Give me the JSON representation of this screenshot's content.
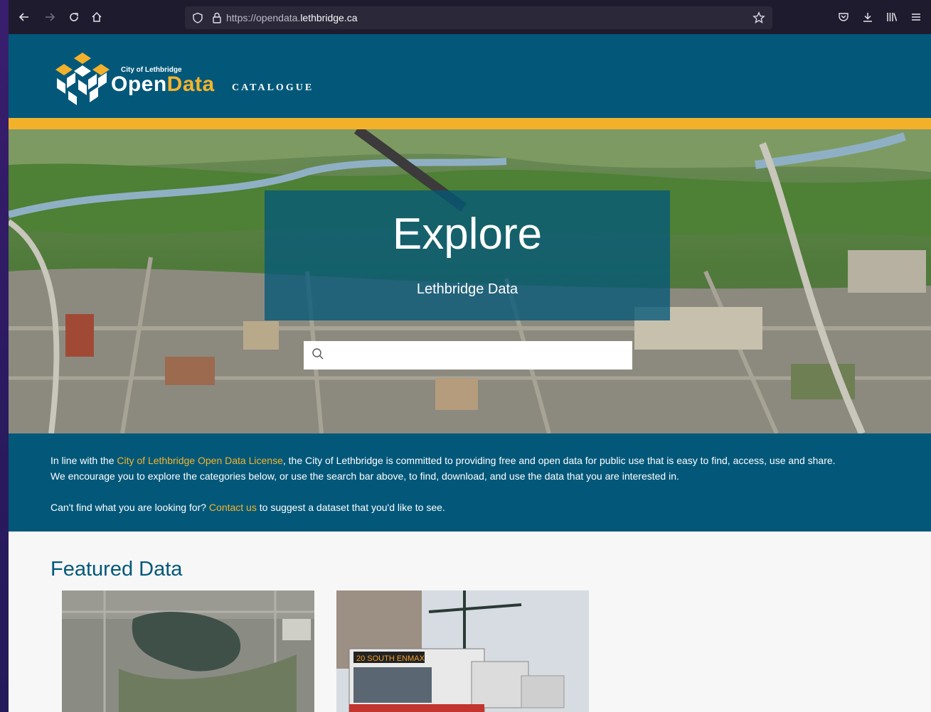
{
  "browser": {
    "url_prefix": "https://opendata.",
    "url_domain": "lethbridge.ca",
    "icons": [
      "back-arrow-icon",
      "forward-arrow-icon",
      "reload-icon",
      "home-icon",
      "shield-icon",
      "lock-icon",
      "star-icon",
      "pocket-icon",
      "download-icon",
      "library-icon",
      "menu-icon"
    ]
  },
  "header": {
    "logo_small": "City of Lethbridge",
    "logo_open": "Open",
    "logo_data": "Data",
    "logo_catalogue": "CATALOGUE"
  },
  "hero": {
    "title": "Explore",
    "subtitle": "Lethbridge Data",
    "search_value": ""
  },
  "intro": {
    "p1_before": "In line with the ",
    "p1_link": "City of Lethbridge Open Data License",
    "p1_after": ", the City of Lethbridge is committed to providing free and open data for public use that is easy to find, access, use and share.",
    "p2": "We encourage you to explore the categories below, or use the search bar above, to find, download, and use the data that you are interested in.",
    "p3_before": "Can't find what you are looking for? ",
    "p3_link": "Contact us",
    "p3_after": " to suggest a dataset that you'd like to see."
  },
  "featured": {
    "title": "Featured Data",
    "bus_sign": "20 SOUTH ENMAX"
  },
  "colors": {
    "brand_blue": "#03587a",
    "brand_gold": "#f3b12b",
    "link_gold": "#f6b32b"
  }
}
